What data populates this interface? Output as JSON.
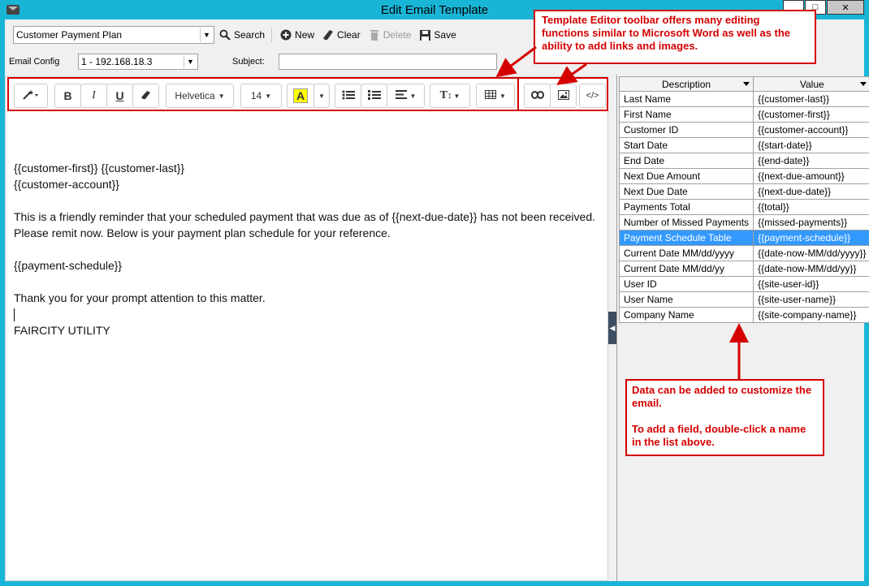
{
  "window": {
    "title": "Edit Email Template"
  },
  "toolbar": {
    "template_select": "Customer Payment Plan",
    "search": "Search",
    "new": "New",
    "clear": "Clear",
    "delete": "Delete",
    "save": "Save"
  },
  "form": {
    "email_config_label": "Email Config",
    "email_config_value": "1 - 192.168.18.3",
    "subject_label": "Subject:",
    "subject_value": ""
  },
  "editor_toolbar": {
    "font_name": "Helvetica",
    "font_size": "14",
    "highlight_letter": "A",
    "code_label": "</>",
    "text_size_label": "T",
    "bold_label": "B",
    "italic_label": "I",
    "underline_label": "U"
  },
  "editor": {
    "lines": [
      "",
      "{{customer-first}} {{customer-last}}",
      "{{customer-account}}",
      "",
      "This is a friendly reminder that your scheduled payment that was due as of {{next-due-date}} has not been received.",
      "Please remit now.  Below is your payment plan schedule for your reference.",
      "",
      "{{payment-schedule}}",
      "",
      "Thank you for your prompt attention to this matter.",
      "",
      "FAIRCITY UTILITY"
    ]
  },
  "fields_grid": {
    "columns": [
      "Description",
      "Value"
    ],
    "rows": [
      [
        "Last Name",
        "{{customer-last}}"
      ],
      [
        "First Name",
        "{{customer-first}}"
      ],
      [
        "Customer ID",
        "{{customer-account}}"
      ],
      [
        "Start Date",
        "{{start-date}}"
      ],
      [
        "End Date",
        "{{end-date}}"
      ],
      [
        "Next Due Amount",
        "{{next-due-amount}}"
      ],
      [
        "Next Due Date",
        "{{next-due-date}}"
      ],
      [
        "Payments Total",
        "{{total}}"
      ],
      [
        "Number of Missed Payments",
        "{{missed-payments}}"
      ],
      [
        "Payment Schedule Table",
        "{{payment-schedule}}"
      ],
      [
        "Current Date MM/dd/yyyy",
        "{{date-now-MM/dd/yyyy}}"
      ],
      [
        "Current Date MM/dd/yy",
        "{{date-now-MM/dd/yy}}"
      ],
      [
        "User ID",
        "{{site-user-id}}"
      ],
      [
        "User Name",
        "{{site-user-name}}"
      ],
      [
        "Company Name",
        "{{site-company-name}}"
      ]
    ],
    "selected_row": 9
  },
  "callouts": {
    "toolbar_note": "Template Editor toolbar offers many editing functions similar to Microsoft Word as well as the ability to add links and images.",
    "data_note_1": "Data can be added to customize the email.",
    "data_note_2": "To add a field, double-click a name in the list above."
  },
  "colors": {
    "accent": "#19b5d6",
    "callout": "#d40000",
    "selection": "#3399ff"
  }
}
